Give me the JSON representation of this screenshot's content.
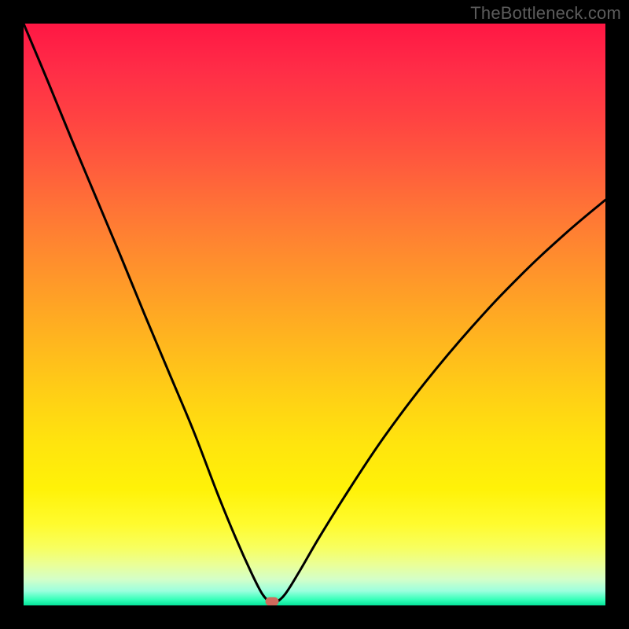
{
  "watermark": "TheBottleneck.com",
  "colors": {
    "frame": "#000000",
    "watermark_text": "#5c5c5c",
    "curve": "#000000",
    "marker": "#cf6a5d",
    "gradient_top": "#ff1744",
    "gradient_mid": "#ffe40e",
    "gradient_bottom": "#04e49a"
  },
  "chart_data": {
    "type": "line",
    "title": "",
    "xlabel": "",
    "ylabel": "",
    "xlim": [
      0,
      100
    ],
    "ylim": [
      0,
      100
    ],
    "grid": false,
    "note": "No axes or ticks rendered; x and y are relative percentages of plot area. Curve shows bottleneck magnitude vs. hardware balance point — 0 at the matched configuration (marker), rising sharply to the left and gradually to the right.",
    "series": [
      {
        "name": "bottleneck-curve",
        "x_frac": [
          0.0,
          0.042,
          0.083,
          0.125,
          0.167,
          0.208,
          0.25,
          0.292,
          0.333,
          0.365,
          0.392,
          0.41,
          0.423,
          0.427,
          0.434,
          0.45,
          0.475,
          0.51,
          0.56,
          0.62,
          0.69,
          0.77,
          0.85,
          0.93,
          1.0
        ],
        "y_frac": [
          1.0,
          0.9,
          0.8,
          0.7,
          0.6,
          0.5,
          0.4,
          0.3,
          0.193,
          0.115,
          0.055,
          0.02,
          0.005,
          0.002,
          0.005,
          0.02,
          0.06,
          0.12,
          0.2,
          0.29,
          0.383,
          0.478,
          0.563,
          0.638,
          0.697
        ]
      }
    ],
    "marker": {
      "x_frac": 0.427,
      "y_frac": 0.007
    }
  }
}
